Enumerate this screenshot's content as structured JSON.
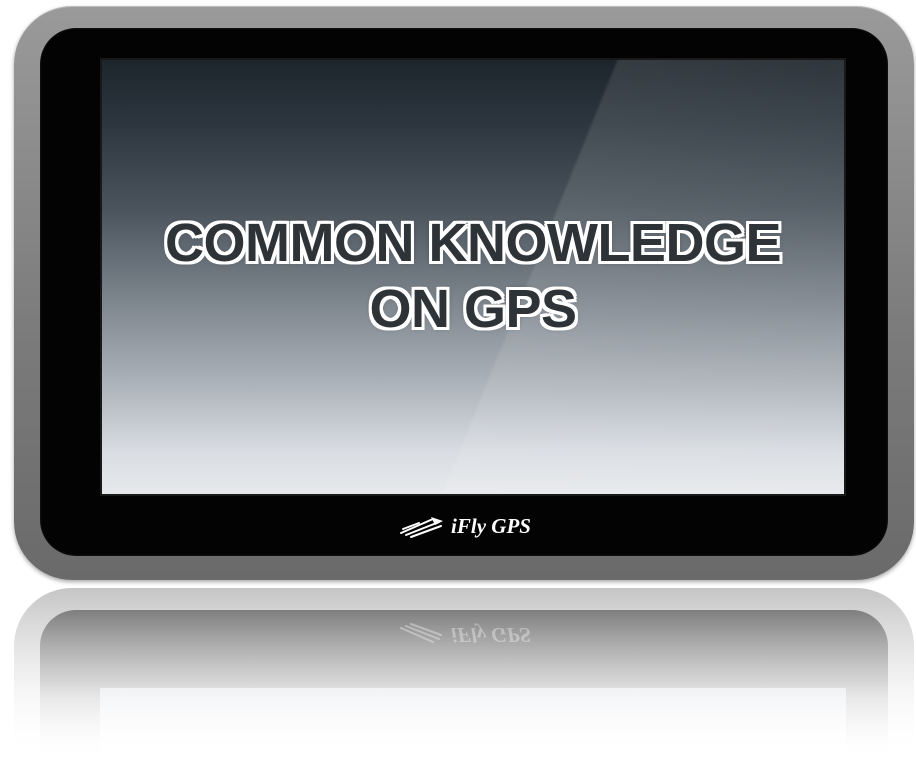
{
  "screen": {
    "headline_line1": "COMMON KNOWLEDGE",
    "headline_line2": "ON GPS"
  },
  "brand": {
    "name": "iFly GPS",
    "icon": "airplane-wings-icon"
  },
  "colors": {
    "device_frame": "#7c7c7c",
    "bezel": "#030303",
    "screen_top": "#1d252c",
    "screen_bottom": "#e7e9ec",
    "headline_text": "#2e3338",
    "headline_outline": "#ffffff"
  }
}
